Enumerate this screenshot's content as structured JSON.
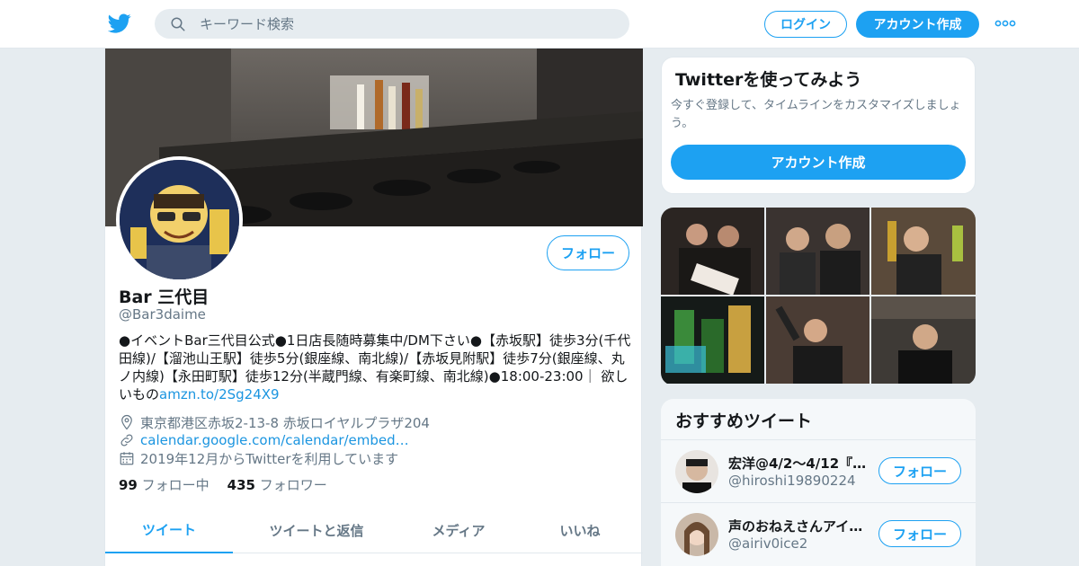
{
  "header": {
    "search_placeholder": "キーワード検索",
    "login_label": "ログイン",
    "signup_label": "アカウント作成"
  },
  "profile": {
    "follow_label": "フォロー",
    "name": "Bar 三代目",
    "handle": "@Bar3daime",
    "bio_text": "●イベントBar三代目公式●1日店長随時募集中/DM下さい●【赤坂駅】徒歩3分(千代田線)/【溜池山王駅】徒歩5分(銀座線、南北線)/【赤坂見附駅】徒歩7分(銀座線、丸ノ内線)【永田町駅】徒歩12分(半蔵門線、有楽町線、南北線)●18:00-23:00｜ 欲しいもの",
    "bio_link": "amzn.to/2Sg24X9",
    "location": "東京都港区赤坂2-13-8 赤坂ロイヤルプラザ204",
    "website": "calendar.google.com/calendar/embed…",
    "joined": "2019年12月からTwitterを利用しています",
    "following_count": "99",
    "following_label": "フォロー中",
    "followers_count": "435",
    "followers_label": "フォロワー",
    "tabs": [
      {
        "label": "ツイート"
      },
      {
        "label": "ツイートと返信"
      },
      {
        "label": "メディア"
      },
      {
        "label": "いいね"
      }
    ]
  },
  "signup_card": {
    "title": "Twitterを使ってみよう",
    "description": "今すぐ登録して、タイムラインをカスタマイズしましょう。",
    "button_label": "アカウント作成"
  },
  "recommended": {
    "title": "おすすめツイート",
    "users": [
      {
        "name": "宏洋@4/2〜4/12『へ…",
        "handle": "@hiroshi19890224",
        "follow_label": "フォロー"
      },
      {
        "name": "声のおねえさんアイ…",
        "handle": "@airiv0ice2",
        "follow_label": "フォロー"
      }
    ]
  },
  "colors": {
    "accent": "#1da1f2",
    "link": "#1b95e0",
    "muted": "#657786",
    "background": "#e6ecf0"
  },
  "icons": [
    "twitter-bird-icon",
    "search-icon",
    "more-dots-icon",
    "location-pin-icon",
    "link-icon",
    "calendar-icon"
  ]
}
